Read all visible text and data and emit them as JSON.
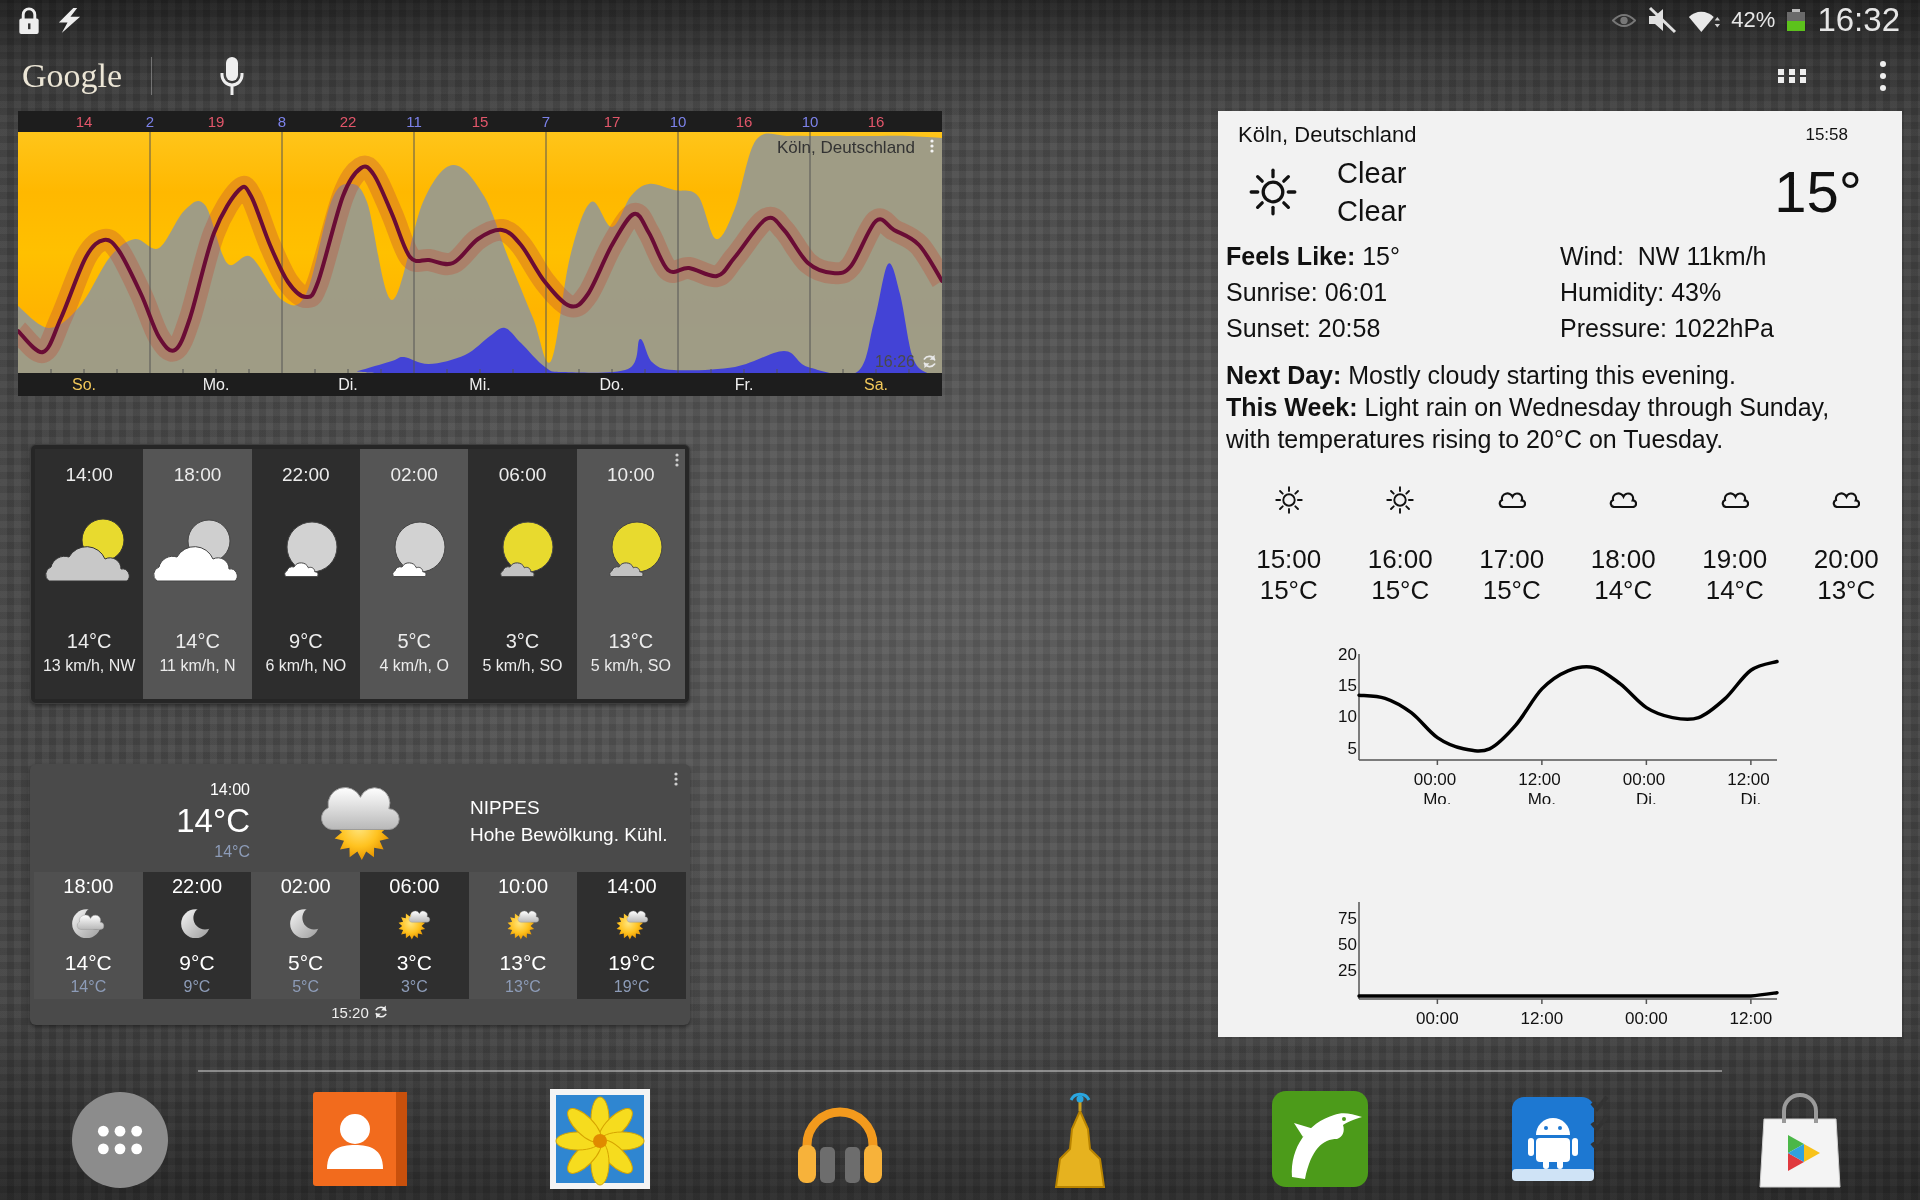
{
  "status_bar": {
    "battery": "42%",
    "time": "16:32"
  },
  "search_bar": {
    "logo": "Google"
  },
  "meteogram": {
    "temperatures": [
      {
        "value": "14",
        "kind": "high"
      },
      {
        "value": "2",
        "kind": "low"
      },
      {
        "value": "19",
        "kind": "high"
      },
      {
        "value": "8",
        "kind": "low"
      },
      {
        "value": "22",
        "kind": "high"
      },
      {
        "value": "11",
        "kind": "low"
      },
      {
        "value": "15",
        "kind": "high"
      },
      {
        "value": "7",
        "kind": "low"
      },
      {
        "value": "17",
        "kind": "high"
      },
      {
        "value": "10",
        "kind": "low"
      },
      {
        "value": "16",
        "kind": "high"
      },
      {
        "value": "10",
        "kind": "low"
      },
      {
        "value": "16",
        "kind": "high"
      }
    ],
    "location": "Köln, Deutschland",
    "updated": "16:26",
    "days": [
      {
        "label": "So.",
        "weekend": true
      },
      {
        "label": "Mo.",
        "weekend": false
      },
      {
        "label": "Di.",
        "weekend": false
      },
      {
        "label": "Mi.",
        "weekend": false
      },
      {
        "label": "Do.",
        "weekend": false
      },
      {
        "label": "Fr.",
        "weekend": false
      },
      {
        "label": "Sa.",
        "weekend": true
      }
    ]
  },
  "hourly_widget": {
    "hours": [
      {
        "time": "14:00",
        "kind": "sun_behind_cloud",
        "temp": "14°C",
        "wind": "13 km/h, NW"
      },
      {
        "time": "18:00",
        "kind": "cloud",
        "temp": "14°C",
        "wind": "11 km/h, N"
      },
      {
        "time": "22:00",
        "kind": "moon_cloud",
        "temp": "9°C",
        "wind": "6 km/h, NO"
      },
      {
        "time": "02:00",
        "kind": "moon_cloud",
        "temp": "5°C",
        "wind": "4 km/h, O"
      },
      {
        "time": "06:00",
        "kind": "sun_cloud",
        "temp": "3°C",
        "wind": "5 km/h, SO"
      },
      {
        "time": "10:00",
        "kind": "sun_cloud",
        "temp": "13°C",
        "wind": "5 km/h, SO"
      }
    ]
  },
  "district_widget": {
    "time": "14:00",
    "temp": "14°C",
    "feels_like": "14°C",
    "kind": "cloud_sun",
    "district": "NIPPES",
    "summary": "Hohe Bewölkung. Kühl.",
    "hours": [
      {
        "time": "18:00",
        "kind": "moon_cloud",
        "temp": "14°C",
        "feels_like": "14°C"
      },
      {
        "time": "22:00",
        "kind": "moon",
        "temp": "9°C",
        "feels_like": "9°C"
      },
      {
        "time": "02:00",
        "kind": "moon",
        "temp": "5°C",
        "feels_like": "5°C"
      },
      {
        "time": "06:00",
        "kind": "sun_cloud",
        "temp": "3°C",
        "feels_like": "3°C"
      },
      {
        "time": "10:00",
        "kind": "sun_cloud",
        "temp": "13°C",
        "feels_like": "13°C"
      },
      {
        "time": "14:00",
        "kind": "sun_cloud",
        "temp": "19°C",
        "feels_like": "19°C"
      }
    ],
    "updated": "15:20"
  },
  "weather_panel": {
    "location": "Köln, Deutschland",
    "time": "15:58",
    "kind": "sun",
    "conditions": [
      "Clear",
      "Clear"
    ],
    "temp": "15°",
    "details": [
      "**Feels Like:** 15°",
      "Wind:  NW 11km/h",
      "Sunrise: 06:01",
      "Humidity: 43%",
      "Sunset: 20:58",
      "Pressure: 1022hPa"
    ],
    "forecast": [
      "**Next Day:** Mostly cloudy starting this evening.",
      "**This Week:** Light rain on Wednesday through Sunday, with temperatures rising to 20°C on Tuesday."
    ],
    "hours": [
      {
        "kind": "sun",
        "time": "15:00",
        "temp": "15°C"
      },
      {
        "kind": "sun",
        "time": "16:00",
        "temp": "15°C"
      },
      {
        "kind": "cloud",
        "time": "17:00",
        "temp": "15°C"
      },
      {
        "kind": "cloud",
        "time": "18:00",
        "temp": "14°C"
      },
      {
        "kind": "cloud",
        "time": "19:00",
        "temp": "14°C"
      },
      {
        "kind": "cloud",
        "time": "20:00",
        "temp": "13°C"
      }
    ],
    "charts": [
      {
        "chart_data": {
          "type": "line",
          "categories": [
            null,
            null,
            null,
            "00:00 Mo.",
            null,
            null,
            null,
            "12:00 Mo.",
            null,
            null,
            null,
            "00:00 Di.",
            null,
            null,
            null,
            "12:00 Di.",
            null
          ],
          "values": [
            13.4,
            12.9,
            10.6,
            6.6,
            4.8,
            4.8,
            8.6,
            14.4,
            17.3,
            17.8,
            15.2,
            11.4,
            9.8,
            9.8,
            12.8,
            17.4,
            18.8
          ],
          "ylim": [
            3,
            20
          ],
          "yticks": [
            5,
            10,
            15,
            20
          ]
        }
      },
      {
        "chart_data": {
          "type": "line",
          "categories": [
            null,
            null,
            null,
            "00:00",
            null,
            null,
            null,
            "12:00",
            null,
            null,
            null,
            "00:00",
            null,
            null,
            null,
            "12:00",
            null
          ],
          "values": [
            0,
            0,
            0,
            0,
            0,
            0,
            0,
            0,
            0,
            0,
            0,
            0,
            0,
            0,
            0,
            0,
            3
          ],
          "ylim": [
            -3,
            90
          ],
          "yticks": [
            25,
            50,
            75
          ]
        }
      }
    ]
  }
}
